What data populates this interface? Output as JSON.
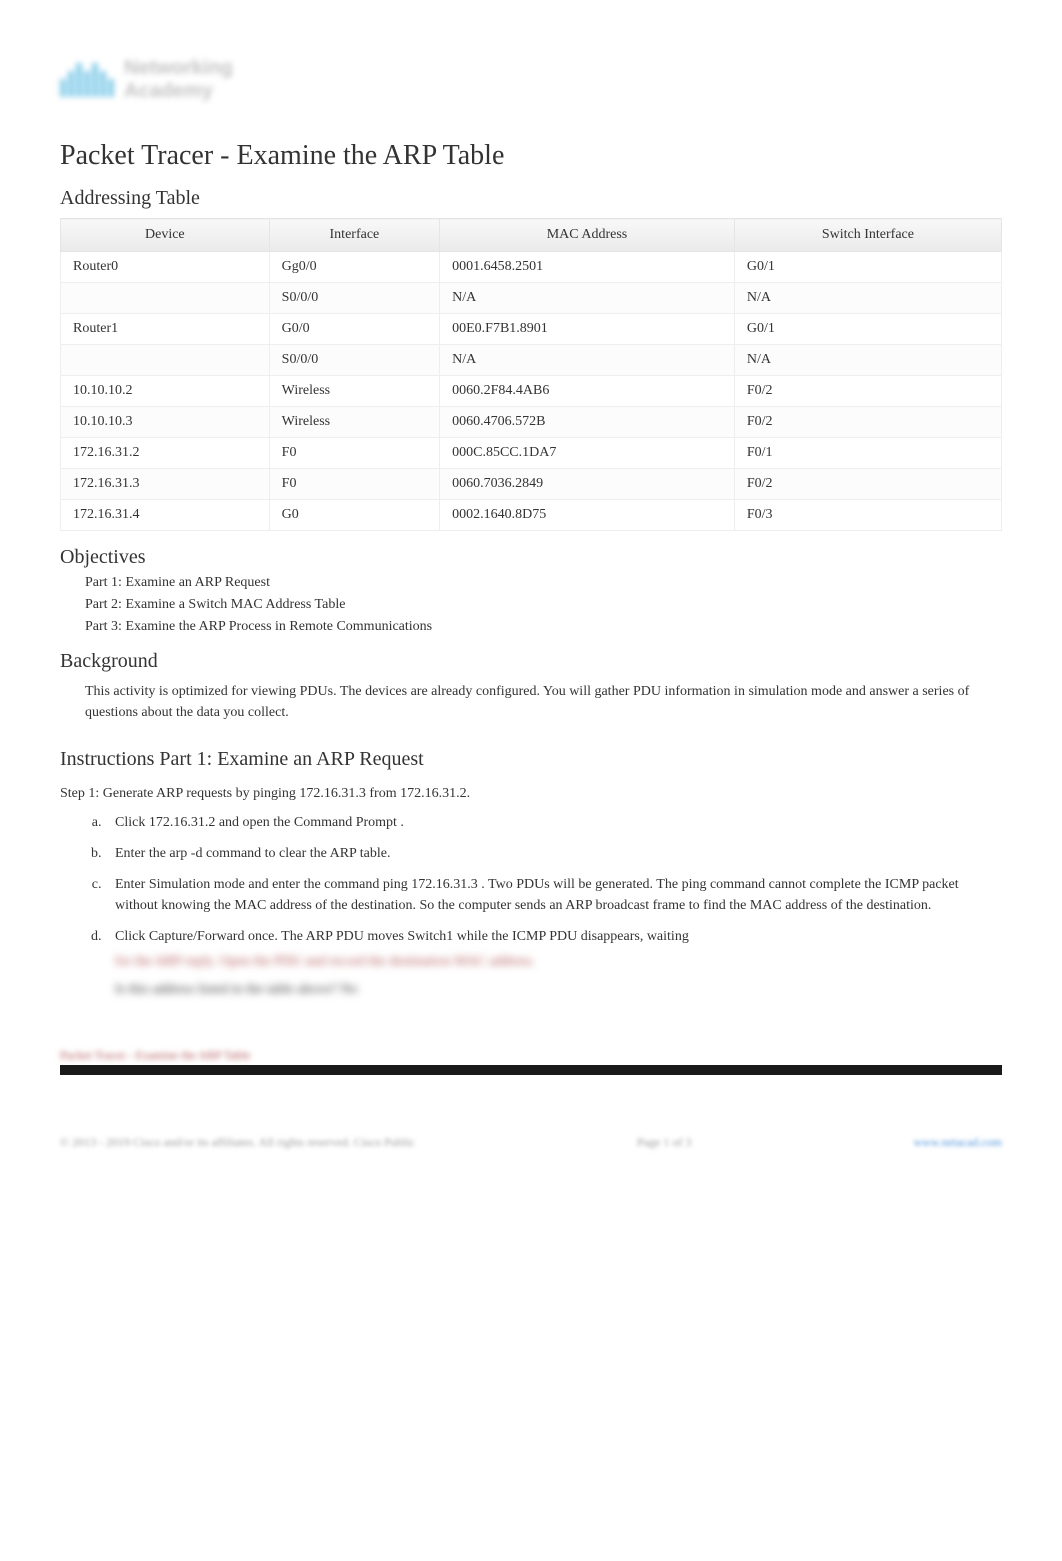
{
  "logo": {
    "brand": "cisco",
    "line1": "Networking",
    "line2": "Academy"
  },
  "title": "Packet Tracer - Examine the ARP Table",
  "addressing": {
    "heading": "Addressing Table",
    "headers": [
      "Device",
      "Interface",
      "MAC Address",
      "Switch Interface"
    ],
    "rows": [
      [
        "Router0",
        "Gg0/0",
        "0001.6458.2501",
        "G0/1"
      ],
      [
        "",
        "S0/0/0",
        "N/A",
        "N/A"
      ],
      [
        "Router1",
        "G0/0",
        "00E0.F7B1.8901",
        "G0/1"
      ],
      [
        "",
        "S0/0/0",
        "N/A",
        "N/A"
      ],
      [
        "10.10.10.2",
        "Wireless",
        "0060.2F84.4AB6",
        "F0/2"
      ],
      [
        "10.10.10.3",
        "Wireless",
        "0060.4706.572B",
        "F0/2"
      ],
      [
        "172.16.31.2",
        "F0",
        "000C.85CC.1DA7",
        "F0/1"
      ],
      [
        "172.16.31.3",
        "F0",
        "0060.7036.2849",
        "F0/2"
      ],
      [
        "172.16.31.4",
        "G0",
        "0002.1640.8D75",
        "F0/3"
      ]
    ]
  },
  "objectives": {
    "heading": "Objectives",
    "items": [
      "Part 1: Examine an ARP Request",
      "Part 2: Examine a Switch MAC Address Table",
      "Part 3: Examine the ARP Process in Remote Communications"
    ]
  },
  "background": {
    "heading": "Background",
    "text": "This activity is optimized for viewing PDUs. The devices are already configured. You will gather PDU information in simulation mode and answer a series of questions about the data you collect."
  },
  "instructions": {
    "heading": "Instructions Part 1: Examine an ARP Request",
    "step1": {
      "title": "Step 1: Generate ARP requests by pinging 172.16.31.3 from 172.16.31.2.",
      "items": [
        "Click 172.16.31.2   and open the   Command Prompt   .",
        "Enter the   arp -d   command to clear the ARP table.",
        "Enter  Simulation   mode and enter the command   ping 172.16.31.3   . Two PDUs will be generated. The   ping   command cannot complete the ICMP packet without knowing the MAC address of the destination. So the computer sends an ARP broadcast frame to find the MAC address of the destination.",
        "Click Capture/Forward   once. The ARP PDU moves   Switch1   while the ICMP PDU disappears, waiting"
      ],
      "blurred_continuation": "for the ARP reply. Open the PDU and record the destination MAC address.",
      "blurred_question": "Is this address listed in the table above? No"
    }
  },
  "footer_title": "Packet Tracer - Examine the ARP Table",
  "footer": {
    "left": "© 2013 - 2019 Cisco and/or its affiliates. All rights reserved. Cisco Public",
    "center": "Page 1 of 3",
    "right": "www.netacad.com"
  }
}
